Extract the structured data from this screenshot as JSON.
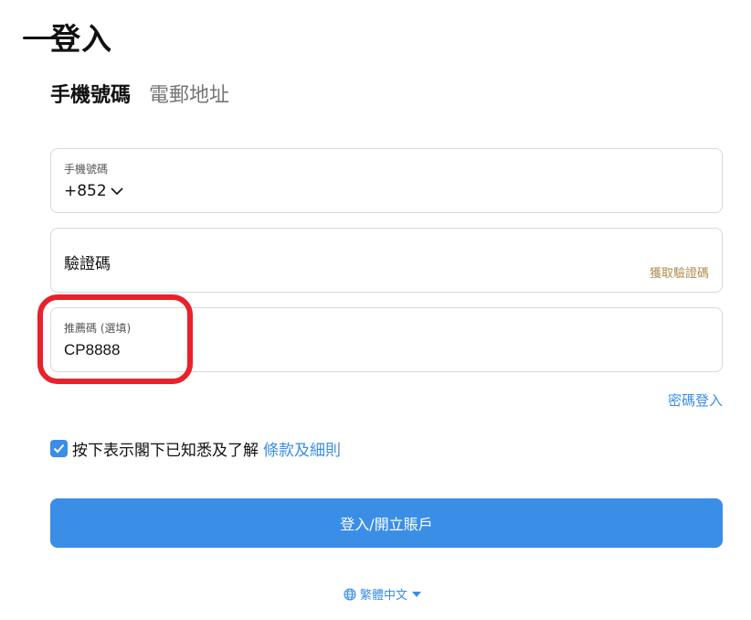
{
  "page": {
    "title": "登入"
  },
  "tabs": [
    {
      "label": "手機號碼",
      "active": true
    },
    {
      "label": "電郵地址",
      "active": false
    }
  ],
  "phone_field": {
    "label": "手機號碼",
    "country_code": "+852"
  },
  "code_field": {
    "placeholder": "驗證碼",
    "get_code_label": "獲取驗證碼"
  },
  "referral_field": {
    "label": "推薦碼 (選填)",
    "value": "CP8888"
  },
  "password_login_label": "密碼登入",
  "terms": {
    "checked": true,
    "text": "按下表示閣下已知悉及了解",
    "link_label": "條款及細則"
  },
  "submit_label": "登入/開立賬戶",
  "language": {
    "label": "繁體中文"
  },
  "colors": {
    "accent": "#3a8ee6",
    "highlight": "#e8212b",
    "gold_link": "#b08a4e"
  }
}
